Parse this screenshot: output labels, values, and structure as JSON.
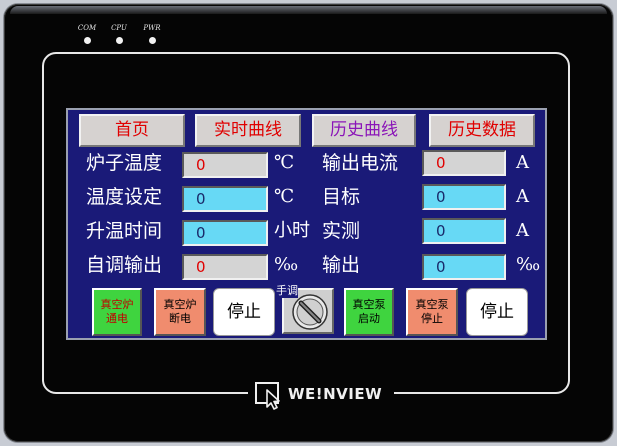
{
  "indicators": [
    {
      "label": "COM"
    },
    {
      "label": "CPU"
    },
    {
      "label": "PWR"
    }
  ],
  "nav": {
    "home": "首页",
    "realtime_curve": "实时曲线",
    "history_curve": "历史曲线",
    "history_data": "历史数据"
  },
  "rows": {
    "furnace_temp": {
      "label": "炉子温度",
      "value": "0",
      "unit": "℃"
    },
    "temp_setpoint": {
      "label": "温度设定",
      "value": "0",
      "unit": "℃"
    },
    "ramp_time": {
      "label": "升温时间",
      "value": "0",
      "unit": "小时"
    },
    "auto_output": {
      "label": "自调输出",
      "value": "0",
      "unit": "‰"
    },
    "output_current": {
      "label": "输出电流",
      "value": "0",
      "unit": "A"
    },
    "target": {
      "label": "目标",
      "value": "0",
      "unit": "A"
    },
    "measured": {
      "label": "实测",
      "value": "0",
      "unit": "A"
    },
    "output": {
      "label": "输出",
      "value": "0",
      "unit": "‰"
    }
  },
  "controls": {
    "furnace_on": "真空炉\n通电",
    "furnace_off": "真空炉\n断电",
    "stop_1": "停止",
    "manual_label": "手调",
    "pump_start": "真空泵\n启动",
    "pump_stop": "真空泵\n停止",
    "stop_2": "停止"
  },
  "brand": {
    "name": "WE!NVIEW"
  },
  "colors": {
    "screen_bg": "#1a1a78",
    "field_readonly": "#d4d4d4",
    "field_input": "#67d9f5",
    "alert_text": "#e00000"
  }
}
